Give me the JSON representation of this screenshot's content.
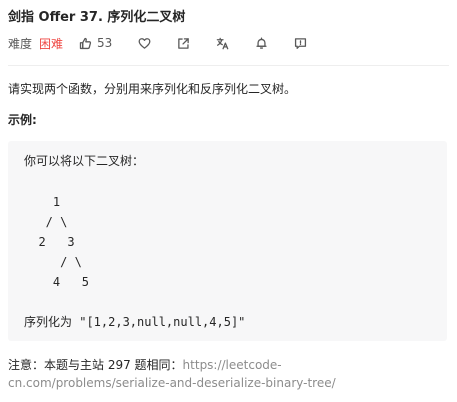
{
  "problem": {
    "title": "剑指 Offer 37. 序列化二叉树",
    "difficulty_label": "难度",
    "difficulty": "困难",
    "likes": "53",
    "description": "请实现两个函数，分别用来序列化和反序列化二叉树。",
    "example_label": "示例:",
    "example_lines": [
      "你可以将以下二叉树：",
      "    1",
      "   / \\",
      "  2   3",
      "     / \\",
      "    4   5",
      "序列化为 \"[1,2,3,null,null,4,5]\""
    ],
    "note_prefix": "注意：本题与主站 297 题相同：",
    "note_link_line1": "https://leetcode-",
    "note_link_line2": "cn.com/problems/serialize-and-deserialize-binary-tree/"
  },
  "toolbar": {
    "like_icon": "thumbs-up-icon",
    "favorite_icon": "heart-icon",
    "share_icon": "share-icon",
    "translate_icon": "translate-icon",
    "notify_icon": "bell-icon",
    "feedback_icon": "feedback-icon"
  },
  "colors": {
    "difficulty_hard": "#ef4743",
    "link_gray": "#8c8c8c",
    "code_background": "#f7f7f8"
  }
}
